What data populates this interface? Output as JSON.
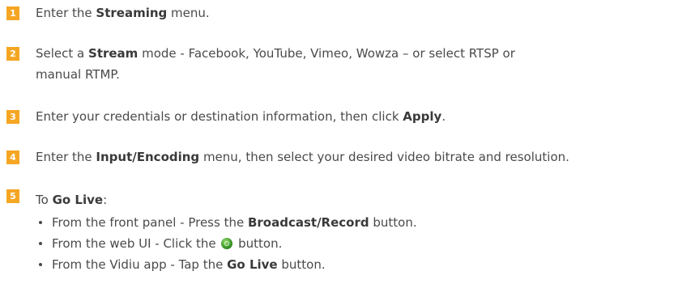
{
  "steps": [
    {
      "number": "1",
      "parts": [
        "Enter the ",
        "Streaming",
        " menu."
      ]
    },
    {
      "number": "2",
      "parts": [
        "Select a ",
        "Stream",
        " mode - Facebook, YouTube, Vimeo,  Wowza – or select RTSP or",
        "manual RTMP."
      ]
    },
    {
      "number": "3",
      "parts": [
        "Enter your credentials or destination information, then click ",
        "Apply",
        "."
      ]
    },
    {
      "number": "4",
      "parts": [
        "Enter the ",
        "Input/Encoding",
        " menu, then select your desired video bitrate and resolution."
      ]
    },
    {
      "number": "5",
      "parts": [
        "To ",
        "Go Live",
        ":"
      ]
    }
  ],
  "go_live_options": [
    {
      "parts": [
        "From the front panel - Press the ",
        "Broadcast/Record",
        " button."
      ]
    },
    {
      "parts": [
        "From the web UI - Click the ",
        " button."
      ],
      "icon": "go-live-icon"
    },
    {
      "parts": [
        "From the Vidiu app - Tap the ",
        "Go Live",
        " button."
      ]
    }
  ],
  "colors": {
    "badge": "#f5a623",
    "text": "#4a4a4a",
    "icon": "#3d9a2a"
  }
}
